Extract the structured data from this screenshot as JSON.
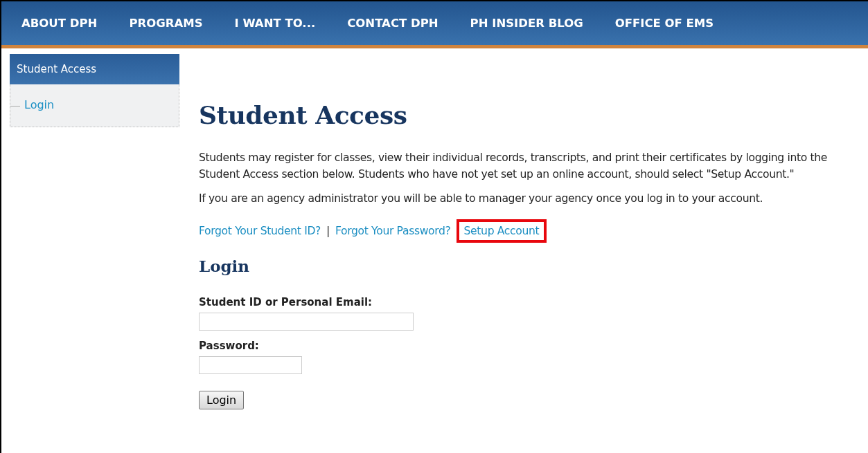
{
  "nav": {
    "items": [
      "ABOUT DPH",
      "PROGRAMS",
      "I WANT TO...",
      "CONTACT DPH",
      "PH INSIDER BLOG",
      "OFFICE OF EMS"
    ]
  },
  "sidebar": {
    "title": "Student Access",
    "items": [
      {
        "label": "Login"
      }
    ]
  },
  "main": {
    "title": "Student Access",
    "paragraphs": [
      "Students may register for classes, view their individual records, transcripts, and print their certificates by logging into the Student Access section below. Students who have not yet set up an online account, should select \"Setup Account.\"",
      "If you are an agency administrator you will be able to manager your agency once you log in to your account."
    ],
    "links": [
      {
        "label": "Forgot Your Student ID?",
        "highlighted": false,
        "separator_after": "|"
      },
      {
        "label": "Forgot Your Password?",
        "highlighted": false
      },
      {
        "label": "Setup Account",
        "highlighted": true
      }
    ],
    "login": {
      "heading": "Login",
      "fields": [
        {
          "label": "Student ID or Personal Email:",
          "kind": "text"
        },
        {
          "label": "Password:",
          "kind": "password"
        }
      ],
      "button": "Login"
    }
  }
}
